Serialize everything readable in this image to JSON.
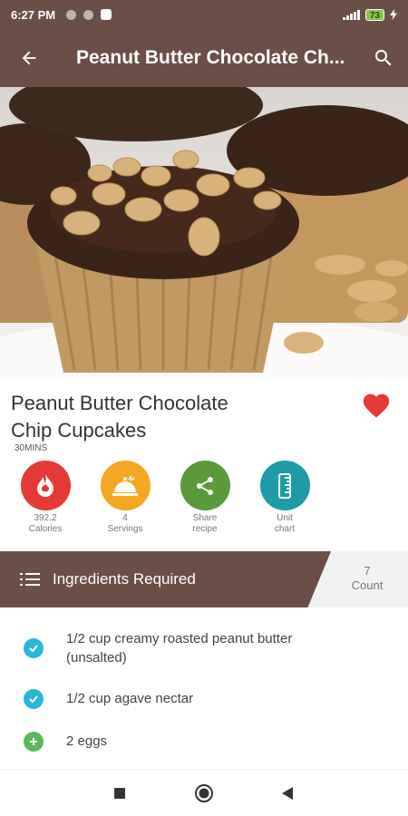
{
  "status_bar": {
    "time": "6:27 PM",
    "battery": "73"
  },
  "app_bar": {
    "title": "Peanut Butter Chocolate Ch..."
  },
  "recipe": {
    "title_line1": "Peanut Butter Chocolate",
    "title_line2": "Chip Cupcakes",
    "time": "30MINS",
    "favorite": true
  },
  "actions": [
    {
      "label1": "392.2",
      "label2": "Calories",
      "color": "#e53935",
      "icon": "flame-icon"
    },
    {
      "label1": "4",
      "label2": "Servings",
      "color": "#f5a623",
      "icon": "serving-tray-icon"
    },
    {
      "label1": "Share",
      "label2": "recipe",
      "color": "#5a9a3a",
      "icon": "share-icon"
    },
    {
      "label1": "Unit",
      "label2": "chart",
      "color": "#1e9ba6",
      "icon": "ruler-icon"
    }
  ],
  "ingredients_header": {
    "label": "Ingredients Required",
    "count_value": "7",
    "count_label": "Count"
  },
  "ingredients": [
    {
      "line1": "1/2 cup creamy roasted peanut butter",
      "line2": "(unsalted)",
      "state": "checked"
    },
    {
      "line1": "1/2 cup agave nectar",
      "line2": "",
      "state": "checked"
    },
    {
      "line1": "2 eggs",
      "line2": "",
      "state": "add"
    }
  ],
  "colors": {
    "brand_brown": "#6b4e45",
    "check_blue": "#29b6d9",
    "add_green": "#5cb85c",
    "heart_red": "#e53935"
  }
}
